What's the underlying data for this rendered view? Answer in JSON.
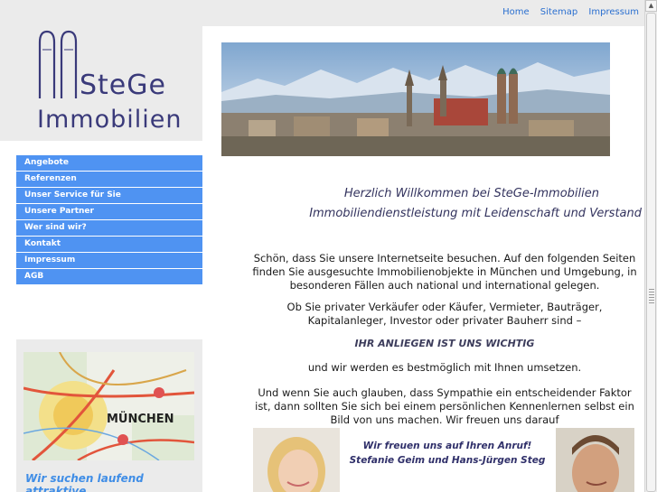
{
  "top_nav": {
    "links": [
      "Home",
      "Sitemap",
      "Impressum"
    ]
  },
  "logo": {
    "line1": "SteGe",
    "line2": "Immobilien"
  },
  "sidebar": {
    "menu": [
      "Angebote",
      "Referenzen",
      "Unser Service für Sie",
      "Unsere Partner",
      "Wer sind wir?",
      "Kontakt",
      "Impressum",
      "AGB"
    ],
    "promo_text": "Wir suchen laufend attraktive"
  },
  "main": {
    "welcome_line1": "Herzlich Willkommen bei SteGe-Immobilien",
    "welcome_line2": "Immobiliendienstleistung mit Leidenschaft und Verstand",
    "para1_l1": "Schön, dass Sie unsere Internetseite besuchen. Auf den folgenden Seiten",
    "para1_l2": "finden Sie ausgesuchte Immobilienobjekte in München und Umgebung, in",
    "para1_l3": "besonderen Fällen auch national und international gelegen.",
    "para2_l1": "Ob Sie privater Verkäufer oder Käufer, Vermieter, Bauträger,",
    "para2_l2": "Kapitalanleger, Investor oder privater Bauherr sind –",
    "para3": "IHR ANLIEGEN IST UNS WICHTIG",
    "para4": "und wir werden es bestmöglich mit Ihnen umsetzen.",
    "para5_l1": "Und wenn Sie auch glauben, dass Sympathie ein entscheidender Faktor",
    "para5_l2": "ist, dann sollten Sie sich bei einem persönlichen Kennenlernen selbst ein",
    "para5_l3": "Bild von uns machen. Wir freuen uns darauf",
    "call_l1": "Wir freuen uns auf Ihren Anruf!",
    "call_l2": "Stefanie Geim und Hans-Jürgen Steg"
  },
  "map": {
    "city_label": "MÜNCHEN"
  },
  "colors": {
    "nav_blue": "#4f93f2",
    "link_blue": "#2a6fd0",
    "panel_grey": "#ebebeb",
    "heading_navy": "#33335e"
  }
}
